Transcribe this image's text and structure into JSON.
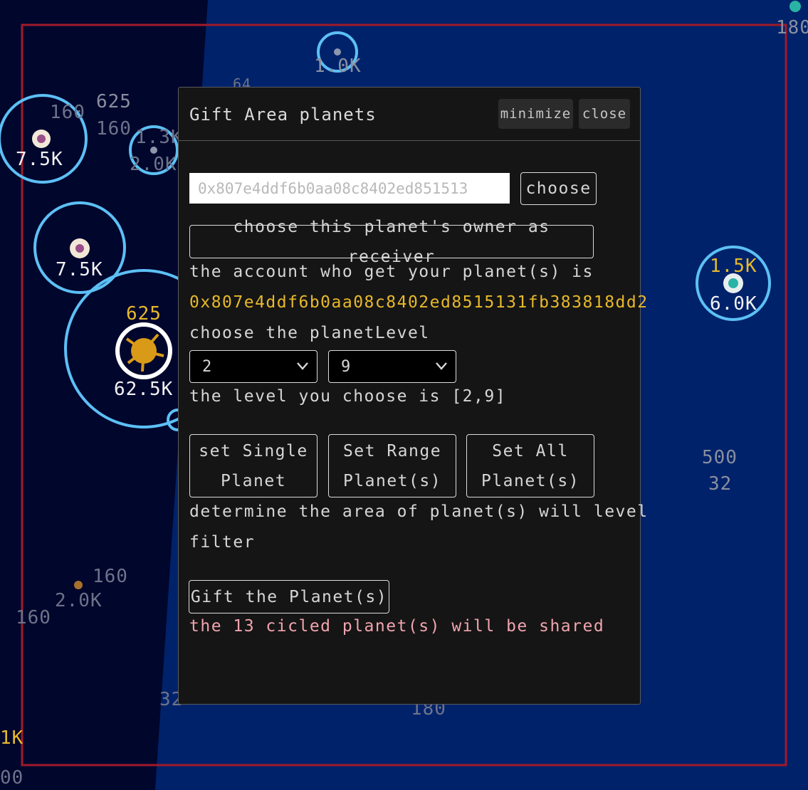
{
  "map": {
    "labels": [
      {
        "text": "180",
        "cls": "lbl-grey"
      },
      {
        "text": "1.0K",
        "cls": "lbl-grey"
      },
      {
        "text": "625",
        "cls": "lbl-grey"
      },
      {
        "text": "160",
        "cls": "lbl-dim"
      },
      {
        "text": "160",
        "cls": "lbl-dim"
      },
      {
        "text": "7.5K",
        "cls": "lbl-white"
      },
      {
        "text": "1.3K",
        "cls": "lbl-dim"
      },
      {
        "text": "2.0K",
        "cls": "lbl-dim"
      },
      {
        "text": "7.5K",
        "cls": "lbl-white"
      },
      {
        "text": "625",
        "cls": "lbl-gold"
      },
      {
        "text": "62.5K",
        "cls": "lbl-white"
      },
      {
        "text": "1.5K",
        "cls": "lbl-gold"
      },
      {
        "text": "6.0K",
        "cls": "lbl-white"
      },
      {
        "text": "500",
        "cls": "lbl-grey"
      },
      {
        "text": "32",
        "cls": "lbl-grey"
      },
      {
        "text": "160",
        "cls": "lbl-dim"
      },
      {
        "text": "2.0K",
        "cls": "lbl-dim"
      },
      {
        "text": "160",
        "cls": "lbl-dim"
      },
      {
        "text": "32",
        "cls": "lbl-dim"
      },
      {
        "text": "180",
        "cls": "lbl-dim"
      },
      {
        "text": "1K",
        "cls": "lbl-gold"
      },
      {
        "text": "00",
        "cls": "lbl-dim"
      },
      {
        "text": "64",
        "cls": "lbl-dim"
      }
    ]
  },
  "modal": {
    "title": "Gift Area planets",
    "minimize_label": "minimize",
    "close_label": "close",
    "planet_input_value": "0x807e4ddf6b0aa08c8402ed851513",
    "choose_label": "choose",
    "owner_button_label": "choose this planet's owner as receiver",
    "receiver_prompt": "the account who get your planet(s) is",
    "receiver_address": "0x807e4ddf6b0aa08c8402ed8515131fb383818dd2",
    "level_prompt": "choose the planetLevel",
    "level_min": "2",
    "level_max": "9",
    "level_summary": "the level you choose is [2,9]",
    "set_single_label": "set Single Planet",
    "set_range_label": "Set Range Planet(s)",
    "set_all_label": "Set All Planet(s)",
    "area_note_line1": "determine the area of planet(s) will level",
    "area_note_line2": "filter",
    "gift_label": "Gift the Planet(s)",
    "shared_status": "the 13 cicled planet(s) will be shared"
  },
  "colors": {
    "space_dark": "#02062e",
    "space_blue": "#00226b",
    "border_red": "#a01a2a",
    "ring_blue": "#5cc0f5",
    "gold": "#e8b92a",
    "pink": "#f0a4ae"
  }
}
